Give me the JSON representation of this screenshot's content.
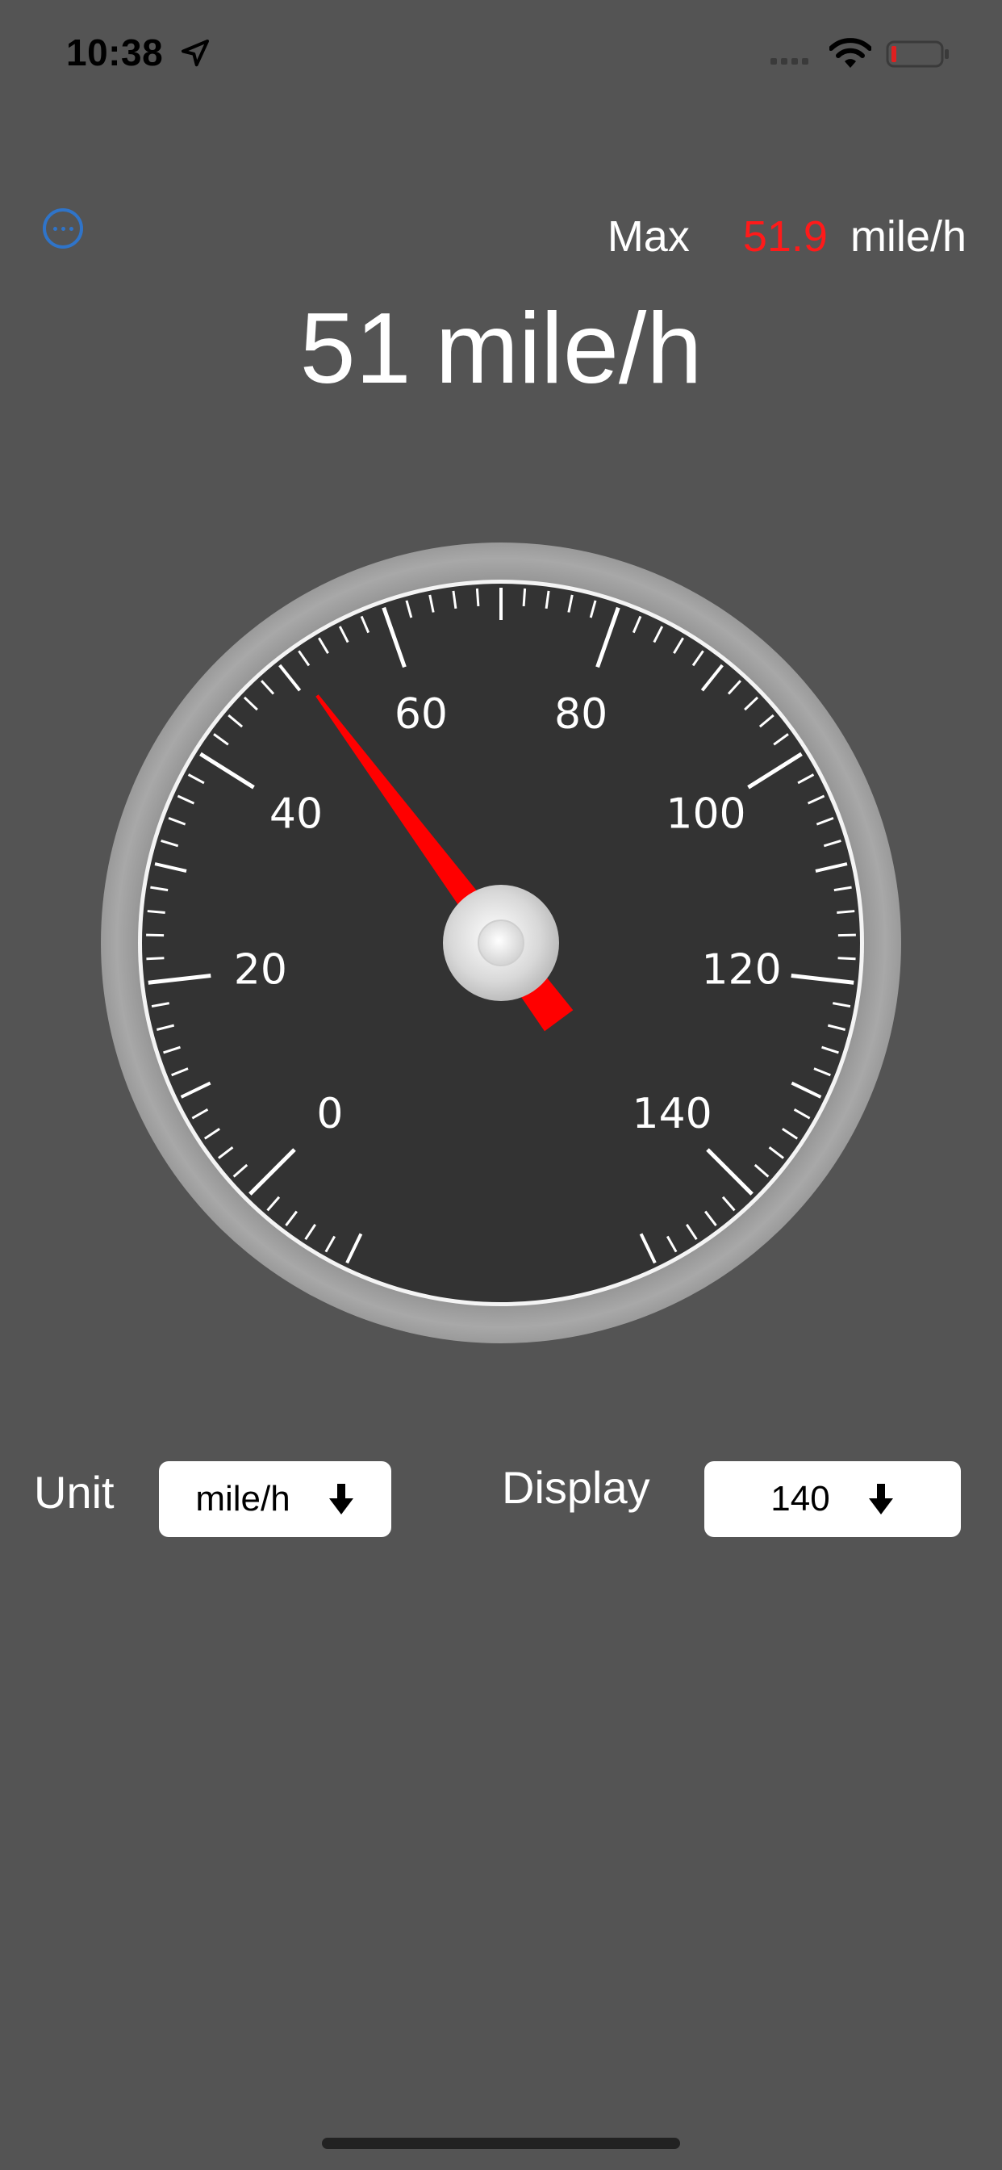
{
  "status_bar": {
    "time": "10:38",
    "icons": [
      "location-arrow-icon",
      "signal-icon",
      "wifi-icon",
      "battery-low-icon"
    ]
  },
  "header": {
    "more_icon": "ellipsis-circle-icon",
    "max_label": "Max",
    "max_value": "51.9",
    "max_unit": "mile/h",
    "max_value_color": "#ff1a1a"
  },
  "current_speed": {
    "value": "51",
    "unit": "mile/h"
  },
  "gauge": {
    "min": 0,
    "max": 140,
    "needle_value": 51,
    "labels": [
      "0",
      "20",
      "40",
      "60",
      "80",
      "100",
      "120",
      "140"
    ],
    "needle_color": "#ff0000",
    "face_color": "#333333",
    "bezel_color": "#9a9a9a"
  },
  "controls": {
    "unit_label": "Unit",
    "unit_value": "mile/h",
    "display_label": "Display",
    "display_value": "140",
    "dropdown_icon": "arrow-down-icon"
  }
}
